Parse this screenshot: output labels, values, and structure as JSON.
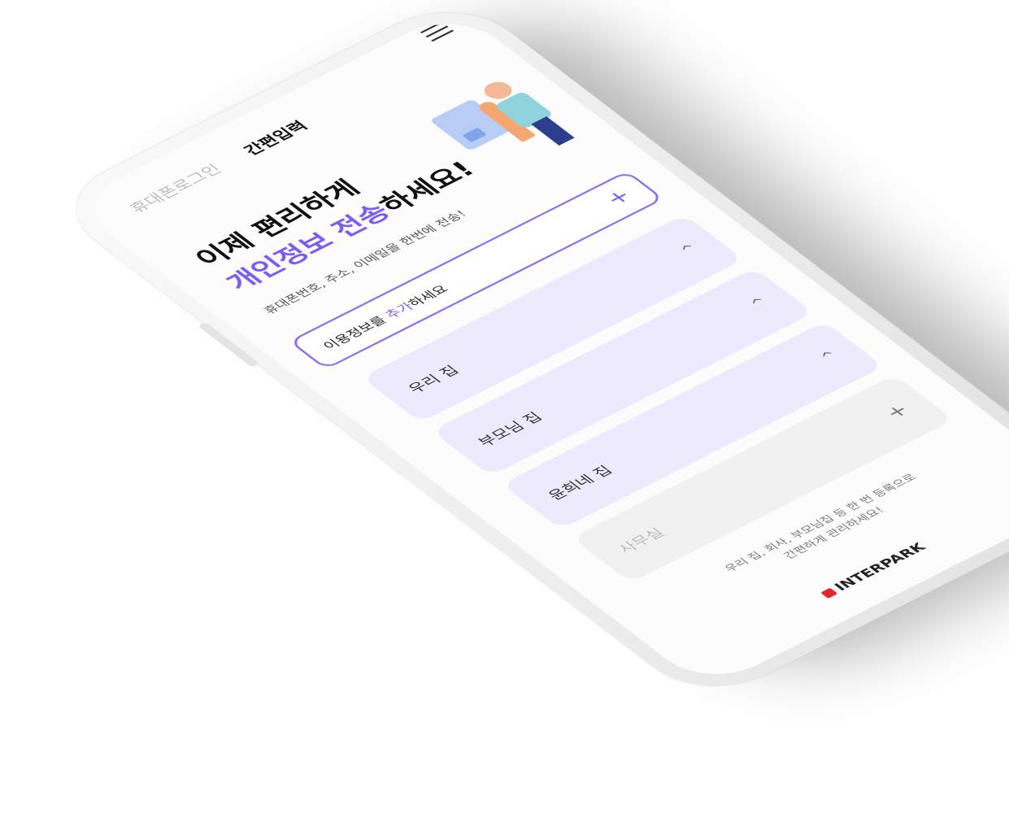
{
  "header": {
    "menu_icon": "hamburger-menu-icon"
  },
  "tabs": [
    {
      "label": "휴대폰로그인",
      "active": false
    },
    {
      "label": "간편입력",
      "active": true
    }
  ],
  "headline": {
    "line1": "이제 편리하게",
    "line2_accent": "개인정보 전송",
    "line2_rest": "하세요!"
  },
  "subtitle": "휴대폰번호, 주소, 이메일을 한번에 전송!",
  "add_box": {
    "prefix": "이용정보를 ",
    "accent": "추가",
    "suffix": "하세요",
    "icon": "plus-icon"
  },
  "items": [
    {
      "label": "우리 집",
      "icon": "chevron-up-icon",
      "glyph": "^"
    },
    {
      "label": "부모님 집",
      "icon": "chevron-up-icon",
      "glyph": "^"
    },
    {
      "label": "윤희네 집",
      "icon": "chevron-up-icon",
      "glyph": "^"
    },
    {
      "label": "사무실",
      "icon": "plus-icon",
      "glyph": "+"
    }
  ],
  "footer": {
    "line1": "우리 집, 회사, 부모님집 등 한 번 등록으로",
    "line2": "간편하게 관리하세요!"
  },
  "logo": "INTERPARK",
  "colors": {
    "accent": "#7b5cf5",
    "card_bg": "#eeeafd",
    "empty_card_bg": "#f1f1f1"
  }
}
